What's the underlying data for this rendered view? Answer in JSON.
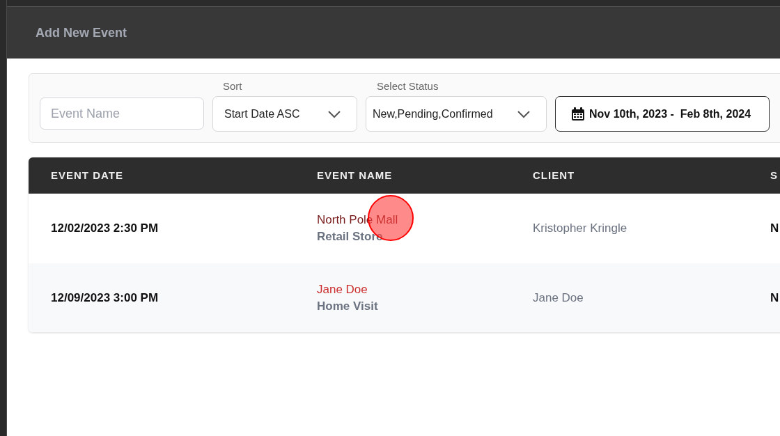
{
  "header": {
    "title": "Add New Event"
  },
  "filters": {
    "event_name": {
      "placeholder": "Event Name"
    },
    "sort": {
      "label": "Sort",
      "value": "Start Date ASC"
    },
    "status": {
      "label": "Select Status",
      "value": "New,Pending,Confirmed"
    },
    "date_range": {
      "value": "Nov 10th, 2023 -  Feb 8th, 2024"
    }
  },
  "table": {
    "columns": [
      "EVENT DATE",
      "EVENT NAME",
      "CLIENT",
      "S"
    ],
    "rows": [
      {
        "event_date": "12/02/2023 2:30 PM",
        "event_name": "North Pole Mall",
        "event_type": "Retail Store",
        "client": "Kristopher Kringle",
        "column_4": "N",
        "hovered": true
      },
      {
        "event_date": "12/09/2023 3:00 PM",
        "event_name": "Jane Doe",
        "event_type": "Home Visit",
        "client": "Jane Doe",
        "column_4": "N",
        "hovered": false
      }
    ]
  }
}
